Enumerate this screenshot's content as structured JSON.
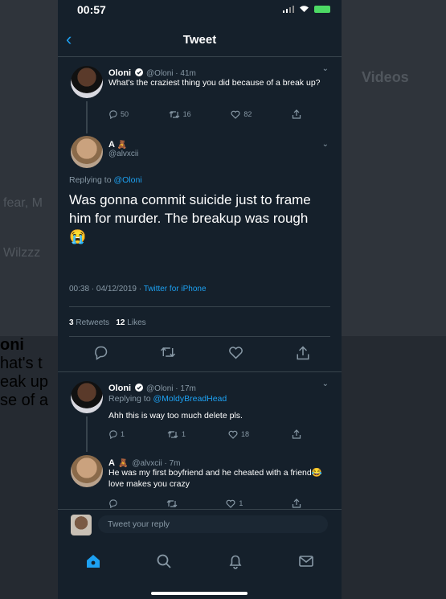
{
  "background": {
    "videos_label": "Videos",
    "name_fragment": "oni",
    "text_fragment_1": "hat's t",
    "text_fragment_2": "eak up",
    "text_fragment_3": "se of a",
    "side_fragment_1": "fear, M",
    "side_fragment_2": "Wilzzz"
  },
  "status": {
    "time": "00:57"
  },
  "nav": {
    "title": "Tweet"
  },
  "tweet1": {
    "name": "Oloni",
    "meta": "@Oloni · 41m",
    "text": "What's the craziest thing you did because of a break up?",
    "replies": "50",
    "retweets": "16",
    "likes": "82"
  },
  "main_tweet": {
    "name": "A",
    "handle": "@alvxcii",
    "replying_prefix": "Replying to",
    "replying_to": "@Oloni",
    "text": "Was gonna commit suicide just to frame him for murder. The breakup was rough",
    "emoji": "😭",
    "timestamp": "00:38 · 04/12/2019 ·",
    "source": "Twitter for iPhone",
    "retweets_count": "3",
    "retweets_label": "Retweets",
    "likes_count": "12",
    "likes_label": "Likes"
  },
  "reply1": {
    "name": "Oloni",
    "meta": "@Oloni · 17m",
    "replying_prefix": "Replying to",
    "replying_to": "@MoldyBreadHead",
    "text": "Ahh this is way too much delete pls.",
    "replies": "1",
    "retweets": "1",
    "likes": "18"
  },
  "reply2": {
    "name": "A",
    "meta": "@alvxcii · 7m",
    "text": "He was my first boyfriend and he cheated with a friend😂 love makes you crazy",
    "likes": "1"
  },
  "composer": {
    "placeholder": "Tweet your reply"
  },
  "colors": {
    "accent": "#1da1f2",
    "background": "#15202b",
    "secondary_text": "#8899a6"
  },
  "icons": [
    "back-chevron-icon",
    "verified-badge-icon",
    "reply-icon",
    "retweet-icon",
    "like-icon",
    "share-icon",
    "home-icon",
    "search-icon",
    "notifications-icon",
    "messages-icon"
  ]
}
